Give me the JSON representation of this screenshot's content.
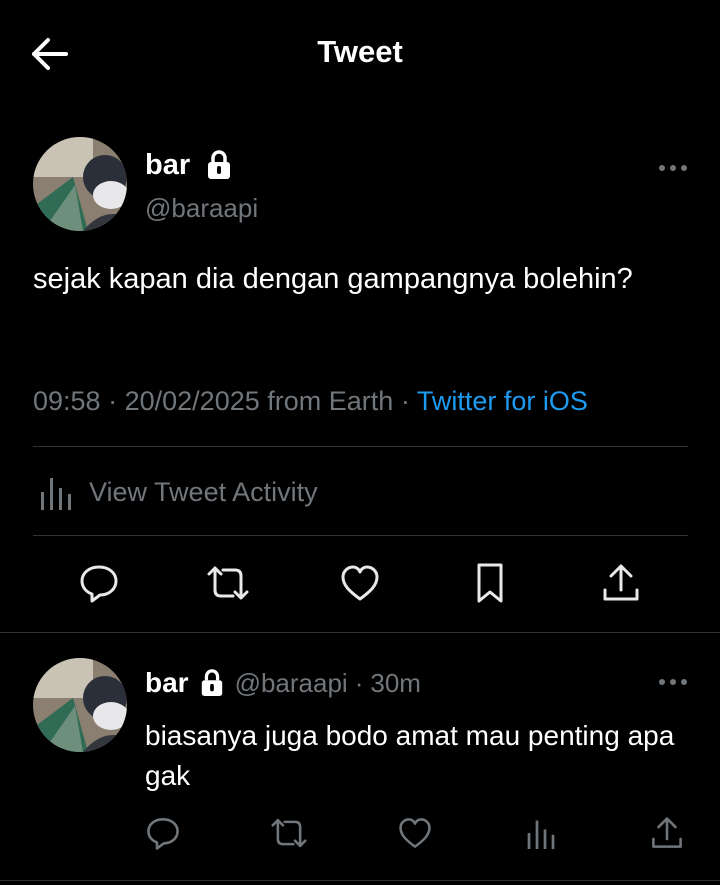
{
  "header": {
    "title": "Tweet"
  },
  "tweet": {
    "name": "bar",
    "handle": "@baraapi",
    "text": "sejak kapan dia dengan gampangnya bolehin?",
    "time": "09:58",
    "sep1": "·",
    "date": "20/02/2025",
    "location": "from Earth",
    "sep2": "·",
    "source": "Twitter for iOS",
    "activity_label": "View Tweet Activity"
  },
  "reply": {
    "name": "bar",
    "handle": "@baraapi",
    "sep": "·",
    "age": "30m",
    "text": "biasanya juga bodo amat mau penting apa gak"
  },
  "colors": {
    "background": "#000000",
    "text": "#e7e9ea",
    "muted": "#71767b",
    "accent": "#1d9bf0",
    "divider": "#2f3336"
  },
  "icons": [
    "back-arrow-icon",
    "lock-icon",
    "more-icon",
    "analytics-icon",
    "reply-icon",
    "retweet-icon",
    "like-icon",
    "bookmark-icon",
    "share-icon"
  ]
}
